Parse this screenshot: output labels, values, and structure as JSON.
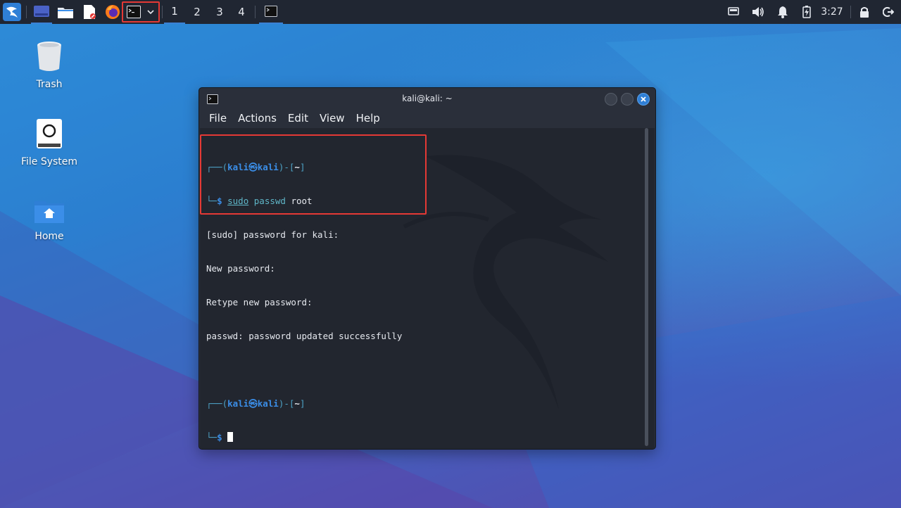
{
  "taskbar": {
    "workspaces": [
      "1",
      "2",
      "3",
      "4"
    ],
    "clock": "3:27"
  },
  "desktop": {
    "icons": [
      {
        "label": "Trash"
      },
      {
        "label": "File System"
      },
      {
        "label": "Home"
      }
    ]
  },
  "window": {
    "title": "kali@kali: ~",
    "menu": [
      "File",
      "Actions",
      "View",
      "Help"
    ]
  },
  "terminal": {
    "prompt_user": "kali",
    "prompt_at": "㉿",
    "prompt_host": "kali",
    "prompt_dir": "~",
    "prompt_dollar": "$",
    "cmd_sudo": "sudo",
    "cmd_passwd": "passwd",
    "cmd_arg": "root",
    "output": [
      "[sudo] password for kali:",
      "New password:",
      "Retype new password:",
      "passwd: password updated successfully"
    ]
  },
  "colors": {
    "highlight": "#e53935",
    "prompt_blue": "#3b8ee8",
    "panel": "#202632"
  }
}
